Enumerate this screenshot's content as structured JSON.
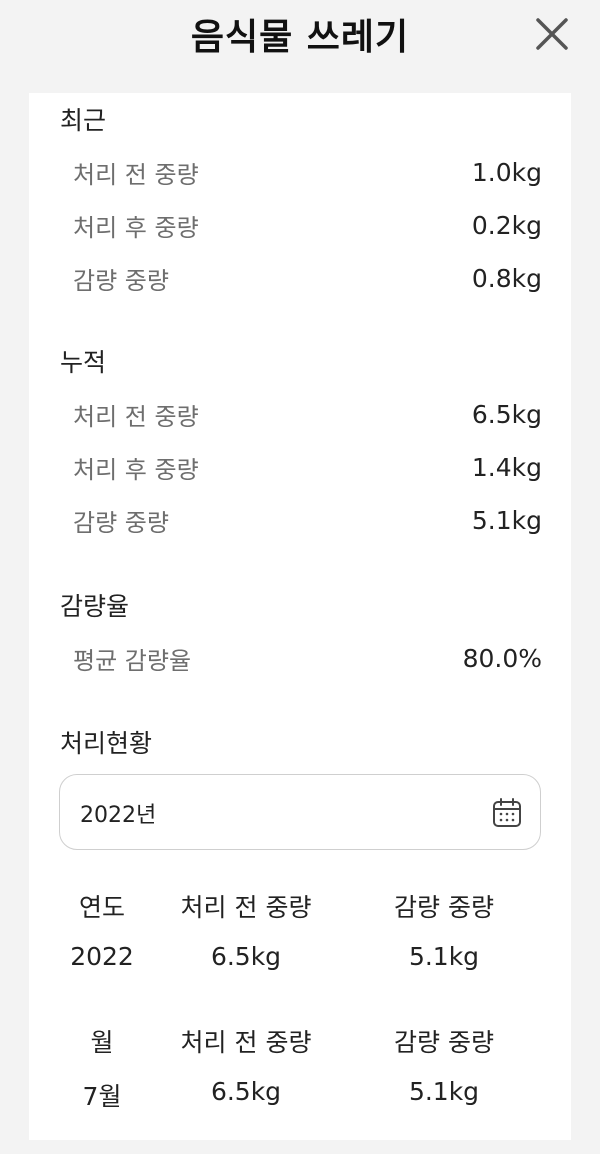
{
  "header": {
    "title": "음식물 쓰레기"
  },
  "recent": {
    "title": "최근",
    "rows": [
      {
        "label": "처리 전 중량",
        "value": "1.0kg"
      },
      {
        "label": "처리 후 중량",
        "value": "0.2kg"
      },
      {
        "label": "감량 중량",
        "value": "0.8kg"
      }
    ]
  },
  "cumulative": {
    "title": "누적",
    "rows": [
      {
        "label": "처리 전 중량",
        "value": "6.5kg"
      },
      {
        "label": "처리 후 중량",
        "value": "1.4kg"
      },
      {
        "label": "감량 중량",
        "value": "5.1kg"
      }
    ]
  },
  "reduction": {
    "title": "감량율",
    "rows": [
      {
        "label": "평균 감량율",
        "value": "80.0%"
      }
    ]
  },
  "status": {
    "title": "처리현황",
    "date_value": "2022년",
    "yearly": {
      "headers": [
        "연도",
        "처리 전 중량",
        "감량 중량"
      ],
      "values": [
        "2022",
        "6.5kg",
        "5.1kg"
      ]
    },
    "monthly": {
      "headers": [
        "월",
        "처리 전 중량",
        "감량 중량"
      ],
      "values": [
        "7월",
        "6.5kg",
        "5.1kg"
      ]
    }
  }
}
